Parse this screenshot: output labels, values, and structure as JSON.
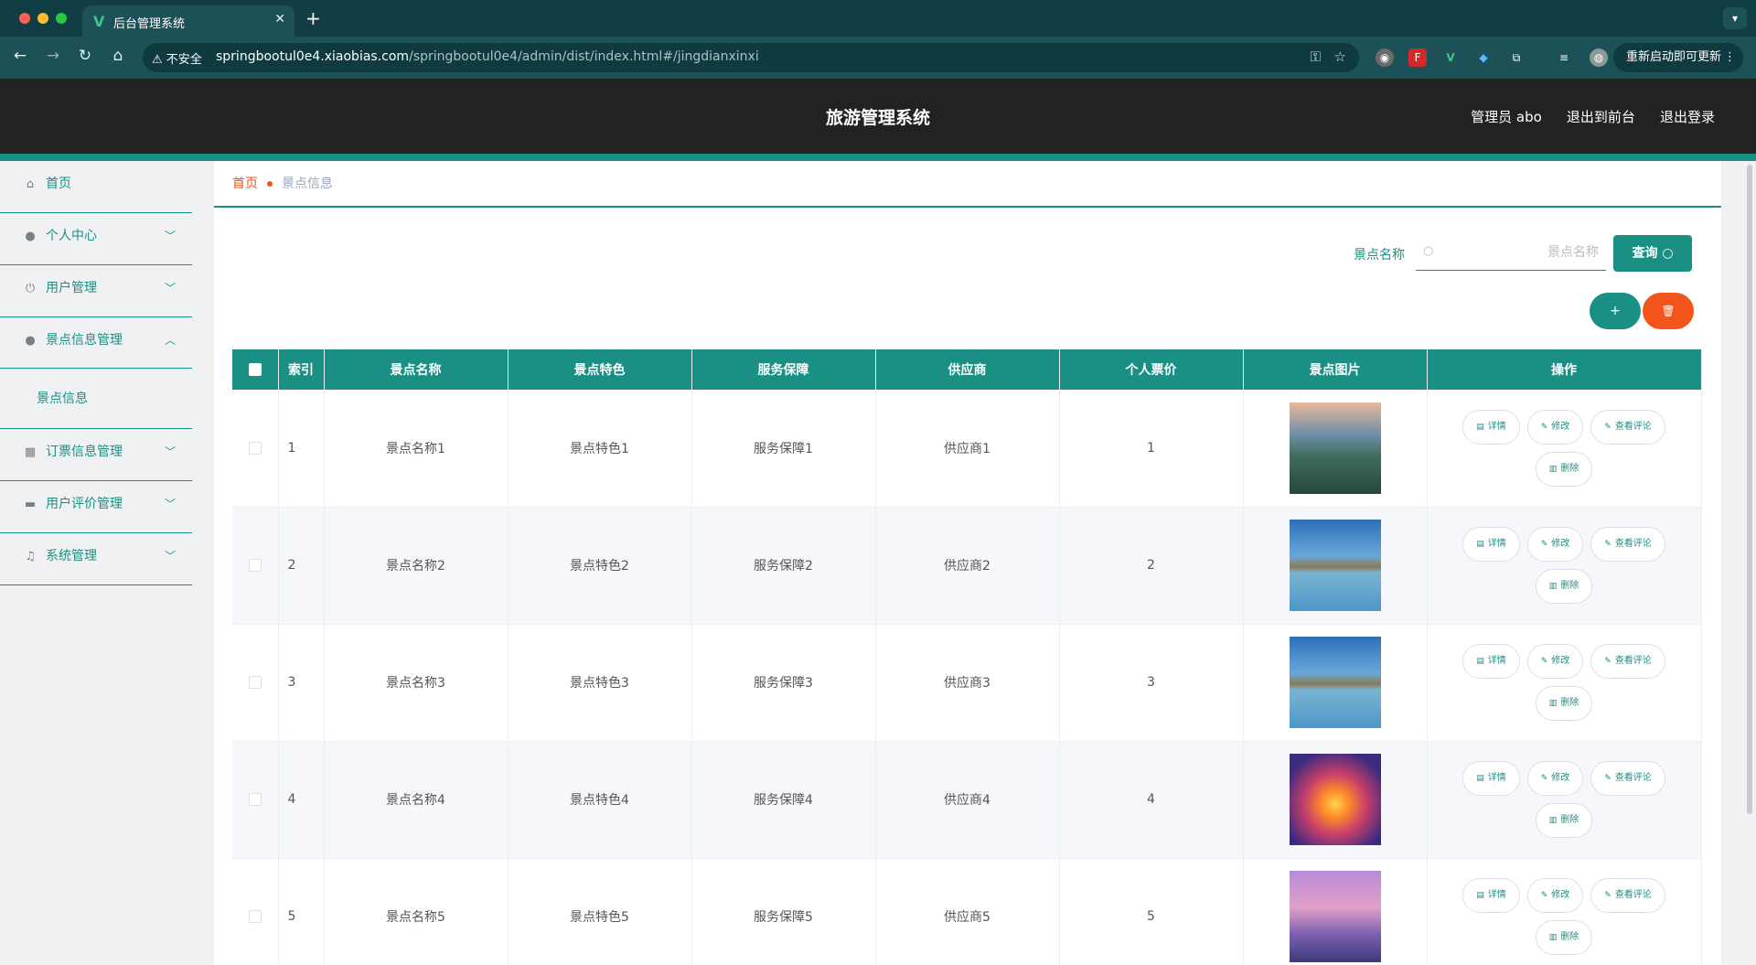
{
  "browser": {
    "tab_icon": "V",
    "tab_title": "后台管理系统",
    "insecure_label": "不安全",
    "url_host": "springbootul0e4.xiaobias.com",
    "url_path": "/springbootul0e4/admin/dist/index.html#/jingdianxinxi",
    "relaunch_label": "重新启动即可更新"
  },
  "header": {
    "title": "旅游管理系统",
    "user": "管理员 abo",
    "to_front": "退出到前台",
    "logout": "退出登录"
  },
  "sidebar": {
    "items": [
      {
        "label": "首页",
        "icon": "home-icon"
      },
      {
        "label": "个人中心",
        "icon": "person-icon"
      },
      {
        "label": "用户管理",
        "icon": "power-icon"
      },
      {
        "label": "景点信息管理",
        "icon": "person-icon"
      },
      {
        "label": "订票信息管理",
        "icon": "grid-icon"
      },
      {
        "label": "用户评价管理",
        "icon": "printer-icon"
      },
      {
        "label": "系统管理",
        "icon": "microphone-icon"
      }
    ],
    "sub_item": "景点信息"
  },
  "breadcrumb": {
    "home": "首页",
    "current": "景点信息"
  },
  "search": {
    "label": "景点名称",
    "placeholder": "景点名称",
    "button": "查询"
  },
  "actions": {
    "add": "+",
    "delete_icon": "trash-icon"
  },
  "table": {
    "headers": [
      "索引",
      "景点名称",
      "景点特色",
      "服务保障",
      "供应商",
      "个人票价",
      "景点图片",
      "操作"
    ],
    "ops": {
      "detail": "详情",
      "edit": "修改",
      "comments": "查看评论",
      "delete": "删除"
    },
    "rows": [
      {
        "index": "1",
        "name": "景点名称1",
        "feature": "景点特色1",
        "service": "服务保障1",
        "supplier": "供应商1",
        "price": "1"
      },
      {
        "index": "2",
        "name": "景点名称2",
        "feature": "景点特色2",
        "service": "服务保障2",
        "supplier": "供应商2",
        "price": "2"
      },
      {
        "index": "3",
        "name": "景点名称3",
        "feature": "景点特色3",
        "service": "服务保障3",
        "supplier": "供应商3",
        "price": "3"
      },
      {
        "index": "4",
        "name": "景点名称4",
        "feature": "景点特色4",
        "service": "服务保障4",
        "supplier": "供应商4",
        "price": "4"
      },
      {
        "index": "5",
        "name": "景点名称5",
        "feature": "景点特色5",
        "service": "服务保障5",
        "supplier": "供应商5",
        "price": "5"
      }
    ]
  },
  "colors": {
    "primary": "#1a9085",
    "danger": "#f2541b",
    "header_bg": "#222222"
  }
}
